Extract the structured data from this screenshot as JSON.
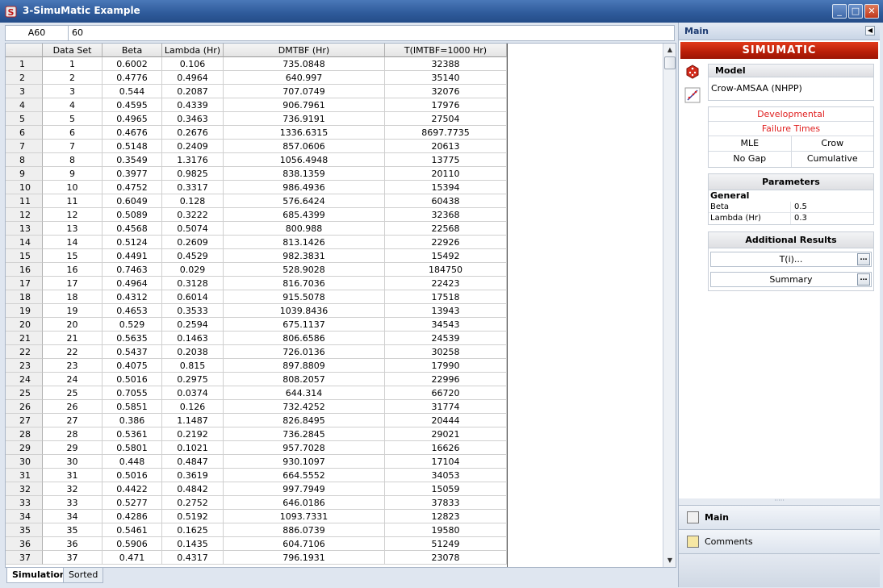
{
  "window": {
    "title": "3-SimuMatic Example",
    "buttons": {
      "minimize": "_",
      "maximize": "□",
      "close": "✕"
    }
  },
  "formula_bar": {
    "cell_ref": "A60",
    "value": "60"
  },
  "grid": {
    "columns": [
      "Data Set",
      "Beta",
      "Lambda (Hr)",
      "DMTBF (Hr)",
      "T(IMTBF=1000 Hr)"
    ],
    "rows": [
      [
        "1",
        "1",
        "0.6002",
        "0.106",
        "735.0848",
        "32388"
      ],
      [
        "2",
        "2",
        "0.4776",
        "0.4964",
        "640.997",
        "35140"
      ],
      [
        "3",
        "3",
        "0.544",
        "0.2087",
        "707.0749",
        "32076"
      ],
      [
        "4",
        "4",
        "0.4595",
        "0.4339",
        "906.7961",
        "17976"
      ],
      [
        "5",
        "5",
        "0.4965",
        "0.3463",
        "736.9191",
        "27504"
      ],
      [
        "6",
        "6",
        "0.4676",
        "0.2676",
        "1336.6315",
        "8697.7735"
      ],
      [
        "7",
        "7",
        "0.5148",
        "0.2409",
        "857.0606",
        "20613"
      ],
      [
        "8",
        "8",
        "0.3549",
        "1.3176",
        "1056.4948",
        "13775"
      ],
      [
        "9",
        "9",
        "0.3977",
        "0.9825",
        "838.1359",
        "20110"
      ],
      [
        "10",
        "10",
        "0.4752",
        "0.3317",
        "986.4936",
        "15394"
      ],
      [
        "11",
        "11",
        "0.6049",
        "0.128",
        "576.6424",
        "60438"
      ],
      [
        "12",
        "12",
        "0.5089",
        "0.3222",
        "685.4399",
        "32368"
      ],
      [
        "13",
        "13",
        "0.4568",
        "0.5074",
        "800.988",
        "22568"
      ],
      [
        "14",
        "14",
        "0.5124",
        "0.2609",
        "813.1426",
        "22926"
      ],
      [
        "15",
        "15",
        "0.4491",
        "0.4529",
        "982.3831",
        "15492"
      ],
      [
        "16",
        "16",
        "0.7463",
        "0.029",
        "528.9028",
        "184750"
      ],
      [
        "17",
        "17",
        "0.4964",
        "0.3128",
        "816.7036",
        "22423"
      ],
      [
        "18",
        "18",
        "0.4312",
        "0.6014",
        "915.5078",
        "17518"
      ],
      [
        "19",
        "19",
        "0.4653",
        "0.3533",
        "1039.8436",
        "13943"
      ],
      [
        "20",
        "20",
        "0.529",
        "0.2594",
        "675.1137",
        "34543"
      ],
      [
        "21",
        "21",
        "0.5635",
        "0.1463",
        "806.6586",
        "24539"
      ],
      [
        "22",
        "22",
        "0.5437",
        "0.2038",
        "726.0136",
        "30258"
      ],
      [
        "23",
        "23",
        "0.4075",
        "0.815",
        "897.8809",
        "17990"
      ],
      [
        "24",
        "24",
        "0.5016",
        "0.2975",
        "808.2057",
        "22996"
      ],
      [
        "25",
        "25",
        "0.7055",
        "0.0374",
        "644.314",
        "66720"
      ],
      [
        "26",
        "26",
        "0.5851",
        "0.126",
        "732.4252",
        "31774"
      ],
      [
        "27",
        "27",
        "0.386",
        "1.1487",
        "826.8495",
        "20444"
      ],
      [
        "28",
        "28",
        "0.5361",
        "0.2192",
        "736.2845",
        "29021"
      ],
      [
        "29",
        "29",
        "0.5801",
        "0.1021",
        "957.7028",
        "16626"
      ],
      [
        "30",
        "30",
        "0.448",
        "0.4847",
        "930.1097",
        "17104"
      ],
      [
        "31",
        "31",
        "0.5016",
        "0.3619",
        "664.5552",
        "34053"
      ],
      [
        "32",
        "32",
        "0.4422",
        "0.4842",
        "997.7949",
        "15059"
      ],
      [
        "33",
        "33",
        "0.5277",
        "0.2752",
        "646.0186",
        "37833"
      ],
      [
        "34",
        "34",
        "0.4286",
        "0.5192",
        "1093.7331",
        "12823"
      ],
      [
        "35",
        "35",
        "0.5461",
        "0.1625",
        "886.0739",
        "19580"
      ],
      [
        "36",
        "36",
        "0.5906",
        "0.1435",
        "604.7106",
        "51249"
      ],
      [
        "37",
        "37",
        "0.471",
        "0.4317",
        "796.1931",
        "23078"
      ]
    ]
  },
  "tabs": [
    "Simulation",
    "Sorted"
  ],
  "panel": {
    "header": "Main",
    "brand": "SIMUMATIC",
    "model_title": "Model",
    "model_value": "Crow-AMSAA (NHPP)",
    "options": {
      "developmental": "Developmental",
      "failure_times": "Failure Times"
    },
    "option_pairs": [
      [
        "MLE",
        "Crow"
      ],
      [
        "No Gap",
        "Cumulative"
      ]
    ],
    "parameters_title": "Parameters",
    "general_label": "General",
    "params": [
      {
        "k": "Beta",
        "v": "0.5"
      },
      {
        "k": "Lambda (Hr)",
        "v": "0.3"
      }
    ],
    "additional_title": "Additional Results",
    "ti_label": "T(i)...",
    "summary_label": "Summary",
    "nav": {
      "main": "Main",
      "comments": "Comments"
    }
  }
}
